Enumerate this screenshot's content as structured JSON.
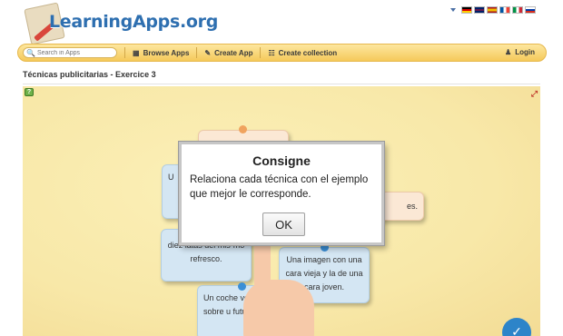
{
  "header": {
    "logo_text": "LearningApps.org",
    "flags": [
      "de-flag",
      "en-flag",
      "es-flag",
      "fr-flag",
      "it-flag",
      "ru-flag"
    ],
    "flag_colors": {
      "de": [
        "#000000",
        "#dd0000",
        "#ffce00"
      ],
      "en": [
        "#012169",
        "#ffffff",
        "#c8102e"
      ],
      "es": [
        "#aa151b",
        "#f1bf00",
        "#aa151b"
      ],
      "fr": [
        "#0055a4",
        "#ffffff",
        "#ef4135"
      ],
      "it": [
        "#009246",
        "#ffffff",
        "#ce2b37"
      ],
      "ru": [
        "#ffffff",
        "#0039a6",
        "#d52b1e"
      ]
    }
  },
  "nav": {
    "search_placeholder": "Search in Apps",
    "browse_label": "Browse Apps",
    "create_label": "Create App",
    "collection_label": "Create collection",
    "login_label": "Login",
    "bar_color": "#f5c95a"
  },
  "page": {
    "title": "Técnicas publicitarias - Exercice 3"
  },
  "app": {
    "cards": {
      "c1": "U",
      "c2": "es.",
      "c3": "Una imagen con una cara vieja y la de una cara joven.",
      "c4": "diez latas del mis-mo refresco.",
      "c5": "Un coche vo sobre u futur"
    },
    "accent_blue": "#3b8fd6",
    "accent_orange": "#f0a35e"
  },
  "modal": {
    "title": "Consigne",
    "text": "Relaciona cada técnica con el ejemplo que mejor le corresponde.",
    "ok_label": "OK"
  }
}
